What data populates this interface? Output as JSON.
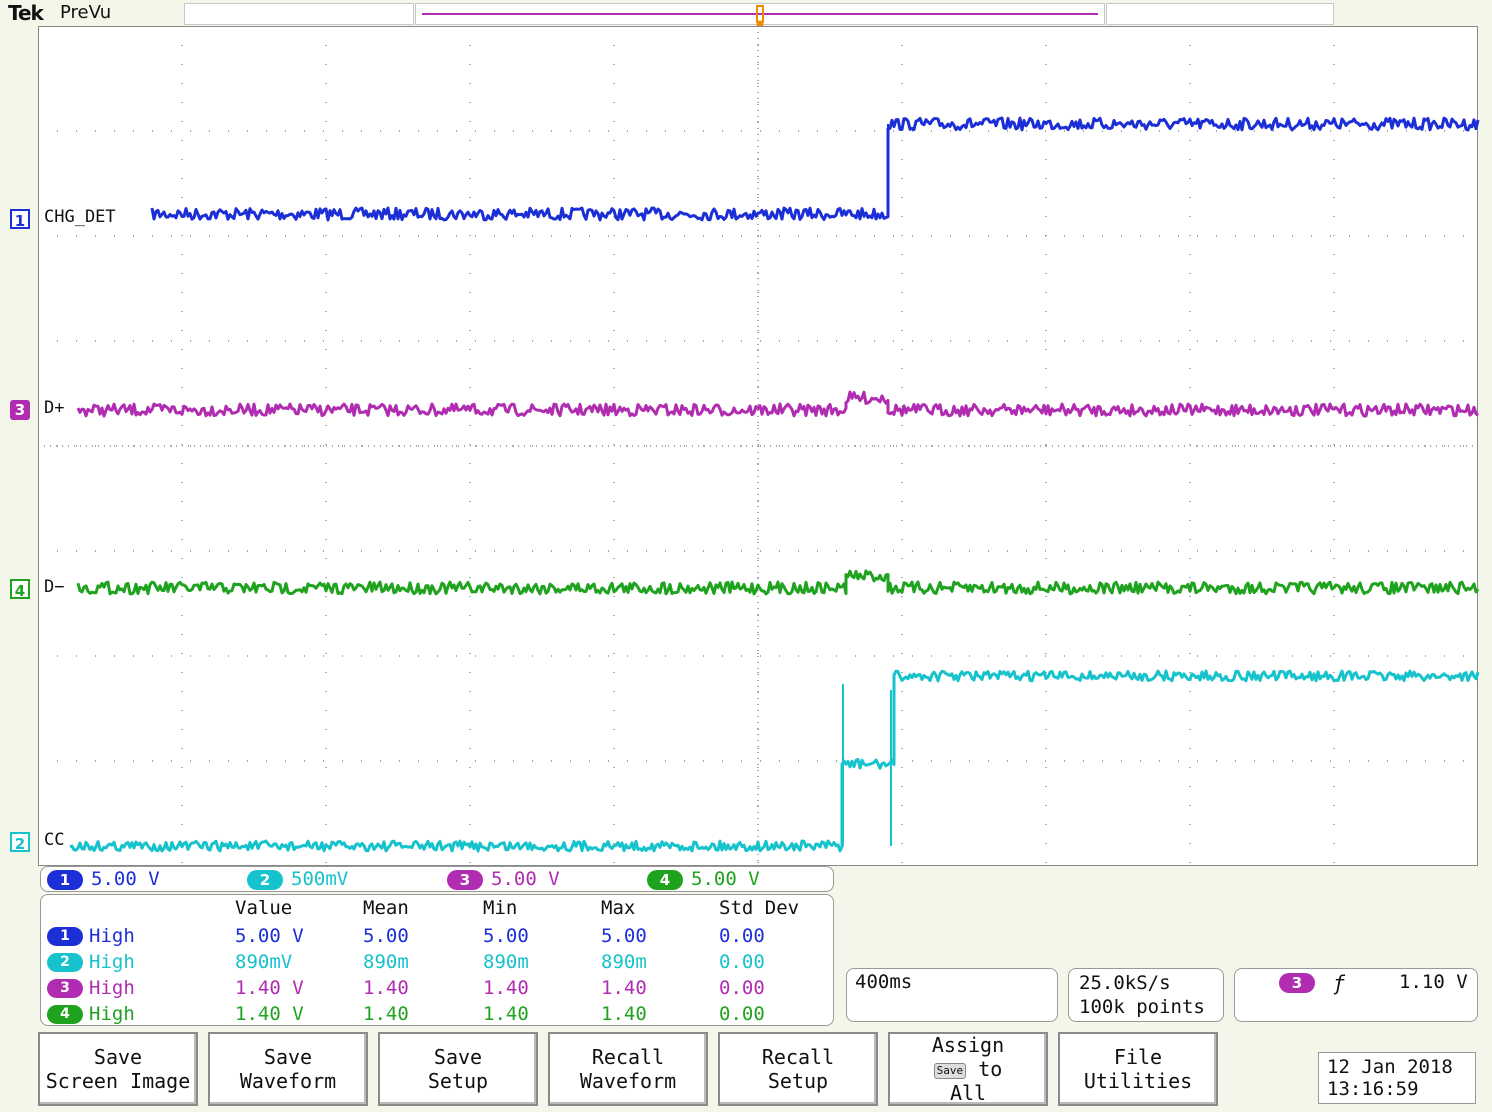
{
  "header": {
    "brand": "Tek",
    "status": "PreVu"
  },
  "colors": {
    "ch1": "#1c2fd6",
    "ch2": "#16c3cc",
    "ch3": "#b02cb0",
    "ch4": "#1fa31f",
    "trigger": "#f08c00"
  },
  "traces": {
    "ch1": {
      "num": "1",
      "label": "CHG_DET"
    },
    "ch2": {
      "num": "2",
      "label": "CC"
    },
    "ch3": {
      "num": "3",
      "label": "D+"
    },
    "ch4": {
      "num": "4",
      "label": "D−"
    }
  },
  "scales": [
    {
      "num": "1",
      "value": "5.00 V",
      "color": "#1c2fd6"
    },
    {
      "num": "2",
      "value": "500mV",
      "color": "#16c3cc"
    },
    {
      "num": "3",
      "value": "5.00 V",
      "color": "#b02cb0"
    },
    {
      "num": "4",
      "value": "5.00 V",
      "color": "#1fa31f"
    }
  ],
  "measurements": {
    "headers": [
      "Value",
      "Mean",
      "Min",
      "Max",
      "Std Dev"
    ],
    "rows": [
      {
        "num": "1",
        "type": "High",
        "value": "5.00 V",
        "mean": "5.00",
        "min": "5.00",
        "max": "5.00",
        "std": "0.00"
      },
      {
        "num": "2",
        "type": "High",
        "value": "890mV",
        "mean": "890m",
        "min": "890m",
        "max": "890m",
        "std": "0.00"
      },
      {
        "num": "3",
        "type": "High",
        "value": "1.40 V",
        "mean": "1.40",
        "min": "1.40",
        "max": "1.40",
        "std": "0.00"
      },
      {
        "num": "4",
        "type": "High",
        "value": "1.40 V",
        "mean": "1.40",
        "min": "1.40",
        "max": "1.40",
        "std": "0.00"
      }
    ]
  },
  "timebase": {
    "scale": "400ms",
    "sample_rate": "25.0kS/s",
    "record_length": "100k points"
  },
  "trigger": {
    "source": "3",
    "slope_symbol": "ƒ",
    "level": "1.10 V"
  },
  "softkeys": [
    {
      "line1": "Save",
      "line2": "Screen Image"
    },
    {
      "line1": "Save",
      "line2": "Waveform"
    },
    {
      "line1": "Save",
      "line2": "Setup"
    },
    {
      "line1": "Recall",
      "line2": "Waveform"
    },
    {
      "line1": "Recall",
      "line2": "Setup"
    },
    {
      "line1": "Assign",
      "chip": "Save",
      "word": "to",
      "line2": "All"
    },
    {
      "line1": "File",
      "line2": "Utilities"
    }
  ],
  "datetime": {
    "date": "12 Jan  2018",
    "time": "13:16:59"
  }
}
